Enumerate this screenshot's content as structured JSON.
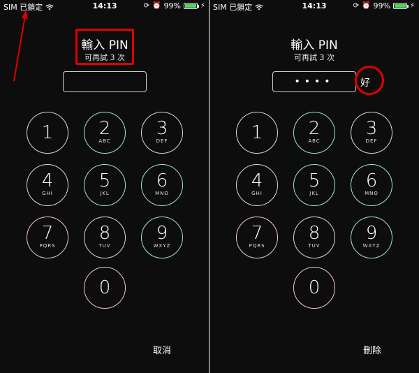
{
  "status_bar": {
    "carrier": "SIM 已鎖定",
    "time": "14:13",
    "battery": "99%",
    "battery_level": 0.99
  },
  "left": {
    "title": "輸入 PIN",
    "subtitle": "可再試 3 次",
    "pin_value": "",
    "bottom_action": "取消"
  },
  "right": {
    "title": "輸入 PIN",
    "subtitle": "可再試 3 次",
    "pin_value": "••••",
    "ok_label": "好",
    "bottom_action": "刪除"
  },
  "keypad": [
    {
      "digit": "1",
      "letters": ""
    },
    {
      "digit": "2",
      "letters": "ABC"
    },
    {
      "digit": "3",
      "letters": "DEF"
    },
    {
      "digit": "4",
      "letters": "GHI"
    },
    {
      "digit": "5",
      "letters": "JKL"
    },
    {
      "digit": "6",
      "letters": "MNO"
    },
    {
      "digit": "7",
      "letters": "PQRS"
    },
    {
      "digit": "8",
      "letters": "TUV"
    },
    {
      "digit": "9",
      "letters": "WXYZ"
    },
    {
      "digit": "0",
      "letters": ""
    }
  ],
  "icons": [
    "wifi-icon",
    "orientation-lock-icon",
    "alarm-icon",
    "battery-icon",
    "charging-icon",
    "arrow-icon"
  ],
  "colors": {
    "annotation_red": "#e00000",
    "battery_green": "#4cd964"
  }
}
